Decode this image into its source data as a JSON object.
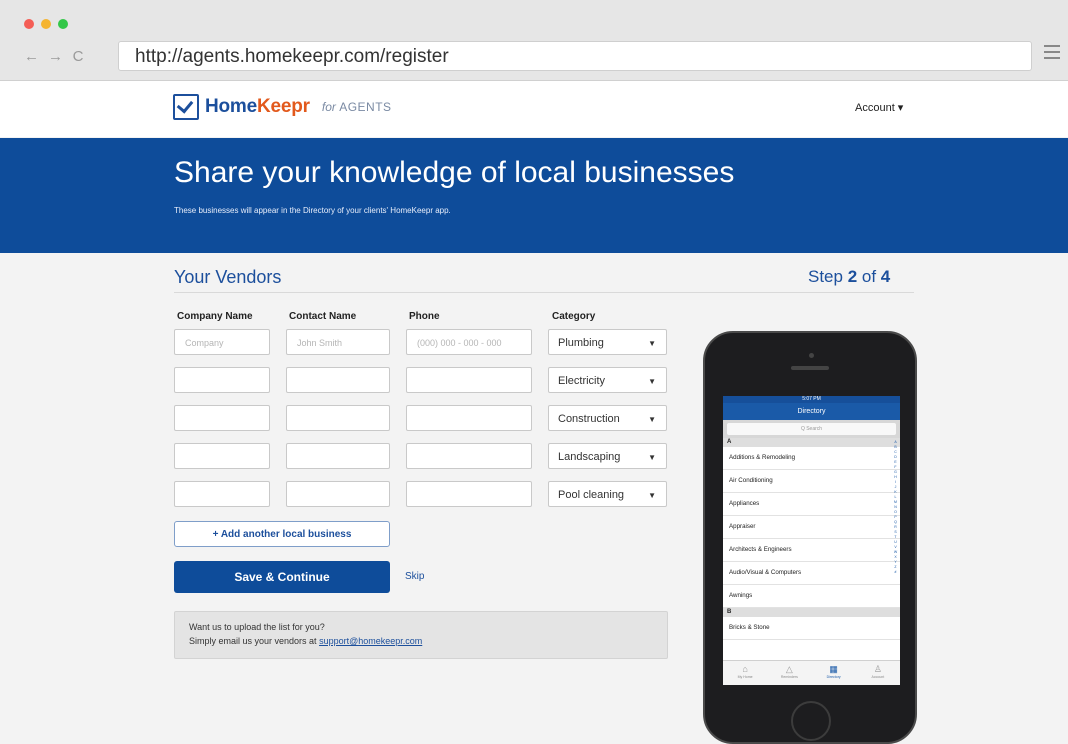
{
  "browser": {
    "url": "http://agents.homekeepr.com/register",
    "dot_colors": [
      "#f45d55",
      "#f5b430",
      "#33c748"
    ],
    "back_icon": "←",
    "forward_icon": "→",
    "reload_icon": "C"
  },
  "header": {
    "brand_home": "Home",
    "brand_keepr": "Keepr",
    "for_label": "for",
    "agents_label": "AGENTS",
    "account_label": "Account ▾"
  },
  "hero": {
    "title": "Share your knowledge of local businesses",
    "subtitle": "These businesses will appear in the Directory of your clients' HomeKeepr app."
  },
  "vendors": {
    "title": "Your Vendors",
    "step_prefix": "Step ",
    "step_current": "2",
    "step_of": " of ",
    "step_total": "4",
    "columns": [
      "Company Name",
      "Contact Name",
      "Phone",
      "Category"
    ],
    "placeholders": {
      "company": "Company",
      "contact": "John Smith",
      "phone": "(000) 000 - 000 - 000"
    },
    "categories": [
      "Plumbing",
      "Electricity",
      "Construction",
      "Landscaping",
      "Pool cleaning"
    ],
    "add_label": "+ Add another local business",
    "save_label": "Save & Continue",
    "skip_label": "Skip",
    "notice_line1": "Want us to upload the list for you?",
    "notice_line2_prefix": "Simply email us your vendors at ",
    "notice_email": "support@homekeepr.com"
  },
  "phone": {
    "status_time": "5:07 PM",
    "directory_title": "Directory",
    "search_placeholder": "Q Search",
    "section_a": "A",
    "items_a": [
      "Additions & Remodeling",
      "Air Conditioning",
      "Appliances",
      "Appraiser",
      "Architects & Engineers",
      "Audio/Visual & Computers",
      "Awnings"
    ],
    "section_b": "B",
    "items_b": [
      "Bricks & Stone"
    ],
    "alphabet": "ABCDEFGHIJKLMNOPQRSTUVWXYZ#",
    "tabs": [
      {
        "label": "My Home",
        "icon": "⌂"
      },
      {
        "label": "Reminders",
        "icon": "△"
      },
      {
        "label": "Directory",
        "icon": "▦"
      },
      {
        "label": "Account",
        "icon": "♙"
      }
    ],
    "active_tab": 2
  }
}
